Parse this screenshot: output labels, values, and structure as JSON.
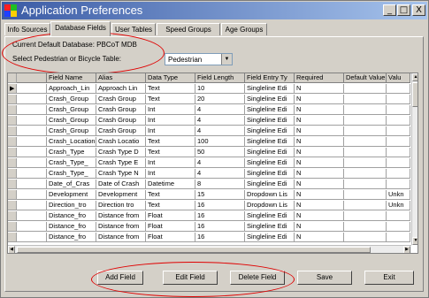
{
  "window": {
    "title": "Application Preferences"
  },
  "title_controls": [
    {
      "name": "minimize-button",
      "glyph": "_"
    },
    {
      "name": "maximize-button",
      "glyph": "□"
    },
    {
      "name": "close-button",
      "glyph": "X"
    }
  ],
  "tabs": [
    "Info Sources",
    "Database Fields",
    "User Tables",
    "Speed Groups",
    "Age Groups"
  ],
  "database": {
    "label": "Current Default Database: PBCoT MDB"
  },
  "table_select": {
    "label": "Select Pedestrian or Bicycle Table:",
    "value": "Pedestrian"
  },
  "grid": {
    "columns": [
      "Field Name",
      "Alias",
      "Data Type",
      "Field Length",
      "Field Entry Ty",
      "Required",
      "Default Value",
      "Valu"
    ],
    "rows": [
      [
        "Approach_Lin",
        "Approach Lin",
        "Text",
        "10",
        "Singleline Edi",
        "N",
        "",
        ""
      ],
      [
        "Crash_Group",
        "Crash Group",
        "Text",
        "20",
        "Singleline Edi",
        "N",
        "",
        ""
      ],
      [
        "Crash_Group",
        "Crash Group",
        "Int",
        "4",
        "Singleline Edi",
        "N",
        "",
        ""
      ],
      [
        "Crash_Group",
        "Crash Group",
        "Int",
        "4",
        "Singleline Edi",
        "N",
        "",
        ""
      ],
      [
        "Crash_Group",
        "Crash Group",
        "Int",
        "4",
        "Singleline Edi",
        "N",
        "",
        ""
      ],
      [
        "Crash_Location",
        "Crash Locatio",
        "Text",
        "100",
        "Singleline Edi",
        "N",
        "",
        ""
      ],
      [
        "Crash_Type",
        "Crash Type D",
        "Text",
        "50",
        "Singleline Edi",
        "N",
        "",
        ""
      ],
      [
        "Crash_Type_",
        "Crash Type E",
        "Int",
        "4",
        "Singleline Edi",
        "N",
        "",
        ""
      ],
      [
        "Crash_Type_",
        "Crash Type N",
        "Int",
        "4",
        "Singleline Edi",
        "N",
        "",
        ""
      ],
      [
        "Date_of_Cras",
        "Date of Crash",
        "Datetime",
        "8",
        "Singleline Edi",
        "N",
        "",
        ""
      ],
      [
        "Development",
        "Development",
        "Text",
        "15",
        "Dropdown Lis",
        "N",
        "",
        "Unkn"
      ],
      [
        "Direction_tro",
        "Direction tro",
        "Text",
        "16",
        "Dropdown Lis",
        "N",
        "",
        "Unkn"
      ],
      [
        "Distance_fro",
        "Distance from",
        "Float",
        "16",
        "Singleline Edi",
        "N",
        "",
        ""
      ],
      [
        "Distance_fro",
        "Distance from",
        "Float",
        "16",
        "Singleline Edi",
        "N",
        "",
        ""
      ],
      [
        "Distance_fro",
        "Distance from",
        "Float",
        "16",
        "Singleline Edi",
        "N",
        "",
        ""
      ]
    ]
  },
  "buttons": [
    "Add Field",
    "Edit Field",
    "Delete Field",
    "Save",
    "Exit"
  ],
  "colors": {
    "annotation": "#e00000",
    "title_start": "#3b5ba5",
    "title_end": "#a6c3ec",
    "face": "#d4d0c8"
  }
}
